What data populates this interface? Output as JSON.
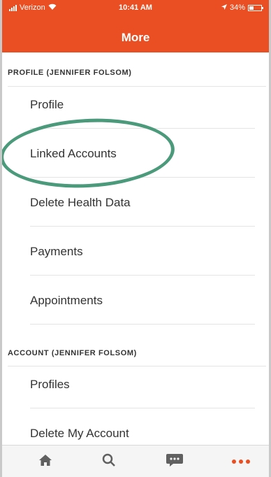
{
  "status_bar": {
    "carrier": "Verizon",
    "time": "10:41 AM",
    "battery": "34%"
  },
  "header": {
    "title": "More"
  },
  "sections": [
    {
      "title": "PROFILE (JENNIFER FOLSOM)",
      "items": [
        "Profile",
        "Linked Accounts",
        "Delete Health Data",
        "Payments",
        "Appointments"
      ]
    },
    {
      "title": "ACCOUNT (JENNIFER FOLSOM)",
      "items": [
        "Profiles",
        "Delete My Account"
      ]
    }
  ],
  "tab_bar": {
    "icons": [
      "home-icon",
      "search-icon",
      "chat-icon",
      "more-icon"
    ]
  },
  "colors": {
    "header": "#e94f22",
    "highlight_ring": "#4b9a7c",
    "text": "#333333",
    "divider": "#e4e4e4"
  }
}
